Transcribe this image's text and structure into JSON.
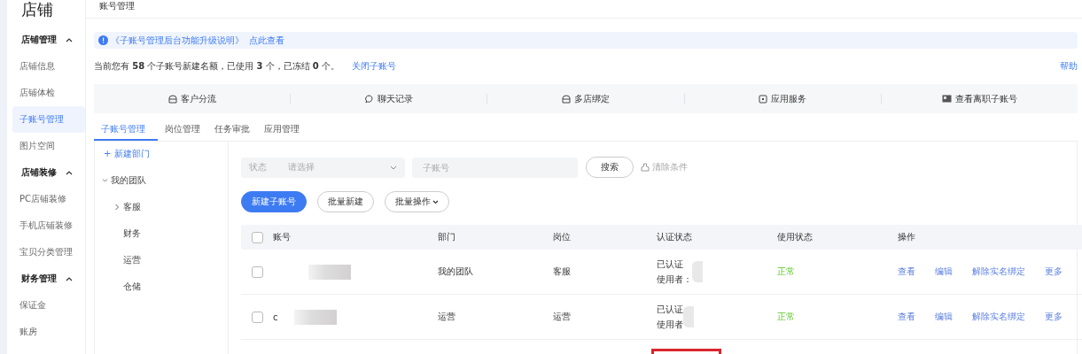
{
  "sidebar": {
    "title": "店铺",
    "groups": [
      {
        "label": "店铺管理",
        "expanded": true,
        "items": [
          {
            "label": "店铺信息",
            "selected": false
          },
          {
            "label": "店铺体检",
            "selected": false
          },
          {
            "label": "子账号管理",
            "selected": true
          },
          {
            "label": "图片空间",
            "selected": false
          }
        ]
      },
      {
        "label": "店铺装修",
        "expanded": true,
        "items": [
          {
            "label": "PC店铺装修",
            "selected": false
          },
          {
            "label": "手机店铺装修",
            "selected": false
          },
          {
            "label": "宝贝分类管理",
            "selected": false
          }
        ]
      },
      {
        "label": "财务管理",
        "expanded": true,
        "items": [
          {
            "label": "保证金",
            "selected": false
          },
          {
            "label": "账房",
            "selected": false
          }
        ]
      }
    ]
  },
  "page_title": "账号管理",
  "notice": {
    "title": "《子账号管理后台功能升级说明》",
    "link": "点此查看"
  },
  "quota": {
    "text": "当前您有 **58** 个子账号新建名额，已使用 **3** 个，已冻结 **0** 个。",
    "link": "关闭子账号",
    "help": "帮助"
  },
  "features": [
    {
      "label": "客户分流"
    },
    {
      "label": "聊天记录"
    },
    {
      "label": "多店绑定"
    },
    {
      "label": "应用服务"
    },
    {
      "label": "查看离职子账号"
    }
  ],
  "tabs": [
    {
      "label": "子账号管理",
      "selected": true
    },
    {
      "label": "岗位管理",
      "selected": false
    },
    {
      "label": "任务审批",
      "selected": false
    },
    {
      "label": "应用管理",
      "selected": false
    }
  ],
  "departments": {
    "new": "+ 新建部门",
    "tree": [
      {
        "label": "我的团队",
        "expanded": true,
        "children": [
          {
            "label": "客服",
            "expanded": false,
            "has_children": true
          },
          {
            "label": "财务",
            "has_children": false
          },
          {
            "label": "运营",
            "has_children": false
          },
          {
            "label": "仓储",
            "has_children": false
          }
        ]
      }
    ]
  },
  "filters": {
    "status_label": "状态",
    "status_placeholder": "请选择",
    "account_placeholder": "子账号",
    "search": "搜索",
    "clear": "清除条件"
  },
  "actions": [
    {
      "label": "新建子账号",
      "kind": "primary"
    },
    {
      "label": "批量新建",
      "kind": "plain"
    },
    {
      "label": "批量操作",
      "kind": "dropdown"
    }
  ],
  "table": {
    "all_checked": false,
    "columns": [
      "账号",
      "部门",
      "岗位",
      "认证状态",
      "使用状态",
      "操作"
    ],
    "rows": [
      {
        "checked": false,
        "department": "我的团队",
        "position": "客服",
        "auth": "已认证",
        "user_label": "使用者：",
        "status": "正常",
        "ops": [
          "查看",
          "编辑",
          "解除实名绑定",
          "更多"
        ],
        "highlighted": false
      },
      {
        "checked": false,
        "account": "c",
        "department": "运营",
        "position": "运营",
        "auth": "已认证",
        "user_label": "使用者",
        "status": "正常",
        "ops": [
          "查看",
          "编辑",
          "解除实名绑定",
          "更多"
        ],
        "highlighted": false
      },
      {
        "highlighted": true
      }
    ]
  }
}
